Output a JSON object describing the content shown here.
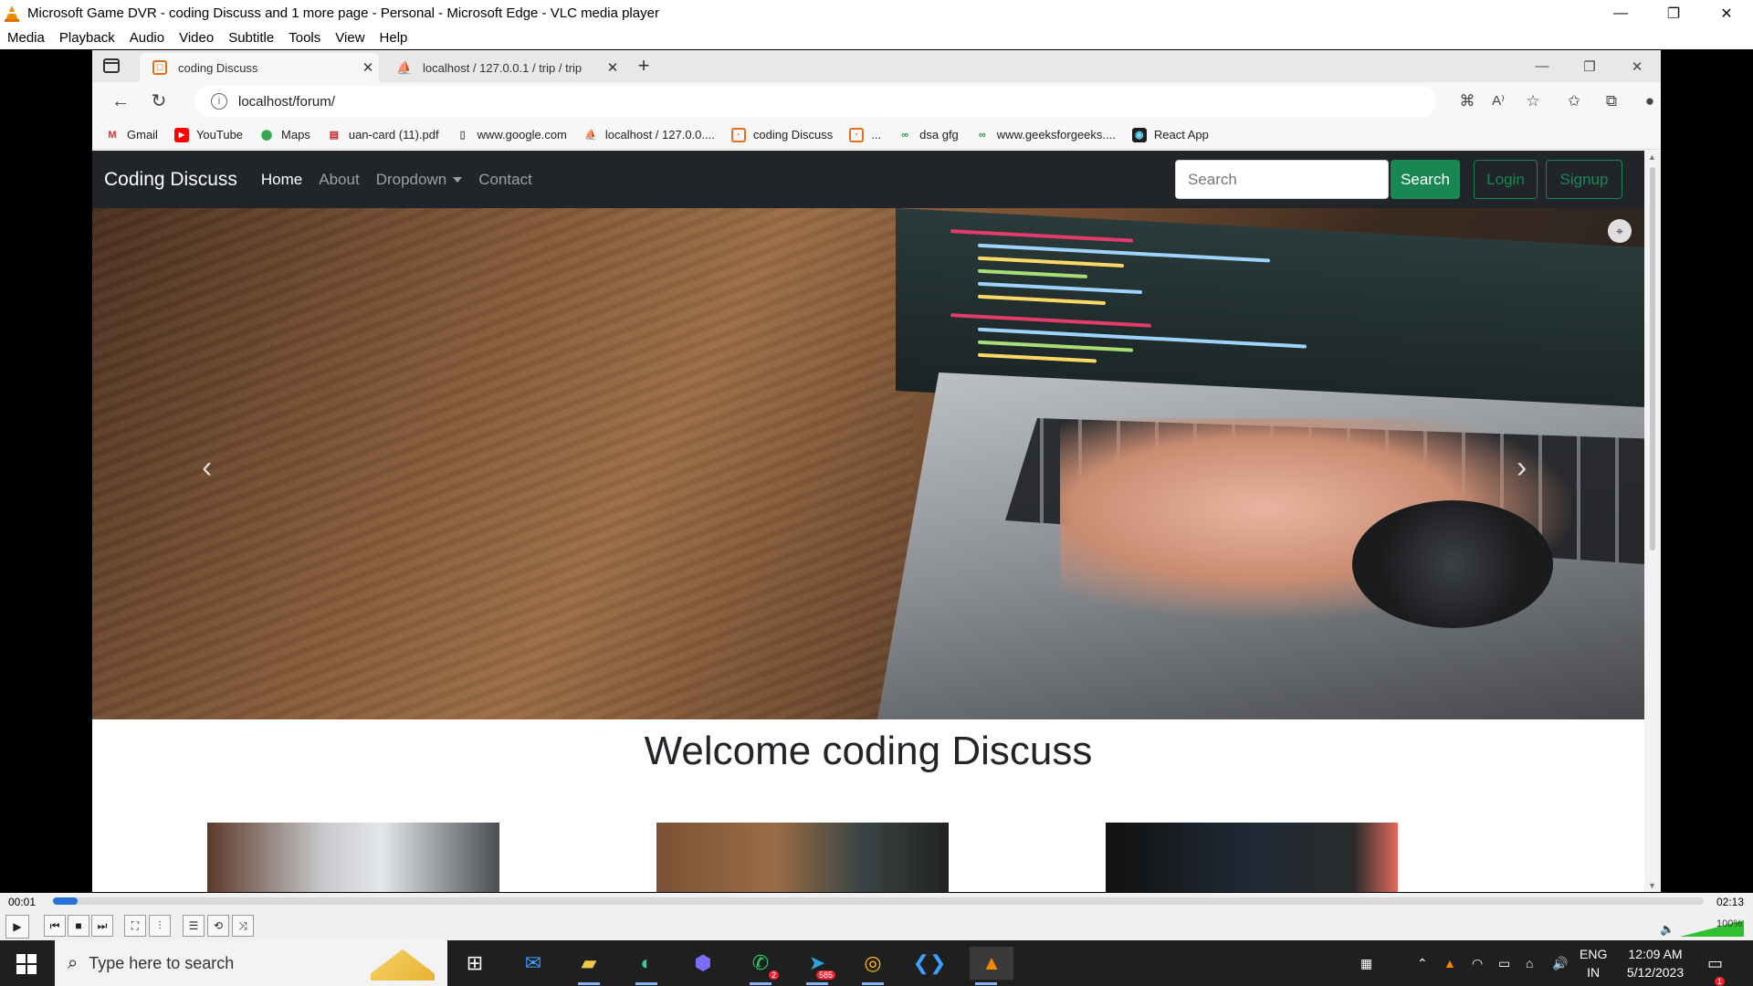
{
  "vlc": {
    "title": "Microsoft Game DVR - coding Discuss and 1 more page - Personal - Microsoft Edge - VLC media player",
    "menu": [
      "Media",
      "Playback",
      "Audio",
      "Video",
      "Subtitle",
      "Tools",
      "View",
      "Help"
    ],
    "time_elapsed": "00:01",
    "time_total": "02:13",
    "progress": 0.012,
    "volume_label": "100%",
    "volume": 1.0
  },
  "edge": {
    "tabs": [
      {
        "label": "coding Discuss",
        "active": true
      },
      {
        "label": "localhost / 127.0.0.1 / trip / trip",
        "active": false
      }
    ],
    "address": "localhost/forum/",
    "bookmarks": [
      {
        "label": "Gmail",
        "icon": "gmail-icon",
        "glyph": "M",
        "color": "#d93025"
      },
      {
        "label": "YouTube",
        "icon": "youtube-icon",
        "glyph": "▶",
        "color": "#ff0000"
      },
      {
        "label": "Maps",
        "icon": "maps-icon",
        "glyph": "⬤",
        "color": "#34a853"
      },
      {
        "label": "uan-card (11).pdf",
        "icon": "pdf-icon",
        "glyph": "▤",
        "color": "#c5221f"
      },
      {
        "label": "www.google.com",
        "icon": "page-icon",
        "glyph": "▯",
        "color": "#555"
      },
      {
        "label": "localhost / 127.0.0....",
        "icon": "phpmyadmin-icon",
        "glyph": "⛵",
        "color": "#e08a00"
      },
      {
        "label": "coding Discuss",
        "icon": "site-icon",
        "glyph": "☐",
        "color": "#e07020"
      },
      {
        "label": "...",
        "icon": "site-icon",
        "glyph": "☐",
        "color": "#e07020"
      },
      {
        "label": "dsa gfg",
        "icon": "gfg-icon",
        "glyph": "∞",
        "color": "#2f8d46"
      },
      {
        "label": "www.geeksforgeeks....",
        "icon": "gfg-icon",
        "glyph": "∞",
        "color": "#2f8d46"
      },
      {
        "label": "React App",
        "icon": "react-icon",
        "glyph": "◉",
        "color": "#1e1e1e"
      }
    ]
  },
  "site": {
    "brand": "Coding Discuss",
    "nav": [
      {
        "label": "Home",
        "active": true
      },
      {
        "label": "About",
        "active": false
      },
      {
        "label": "Dropdown",
        "active": false,
        "dropdown": true
      },
      {
        "label": "Contact",
        "active": false
      }
    ],
    "search_placeholder": "Search",
    "search_button": "Search",
    "login_button": "Login",
    "signup_button": "Signup",
    "welcome": "Welcome coding Discuss",
    "accent": "#198754"
  },
  "taskbar": {
    "search_placeholder": "Type here to search",
    "whatsapp_badge": "2",
    "telegram_badge": "585",
    "lang_line1": "ENG",
    "lang_line2": "IN",
    "time": "12:09 AM",
    "date": "5/12/2023",
    "notifications": "1"
  }
}
